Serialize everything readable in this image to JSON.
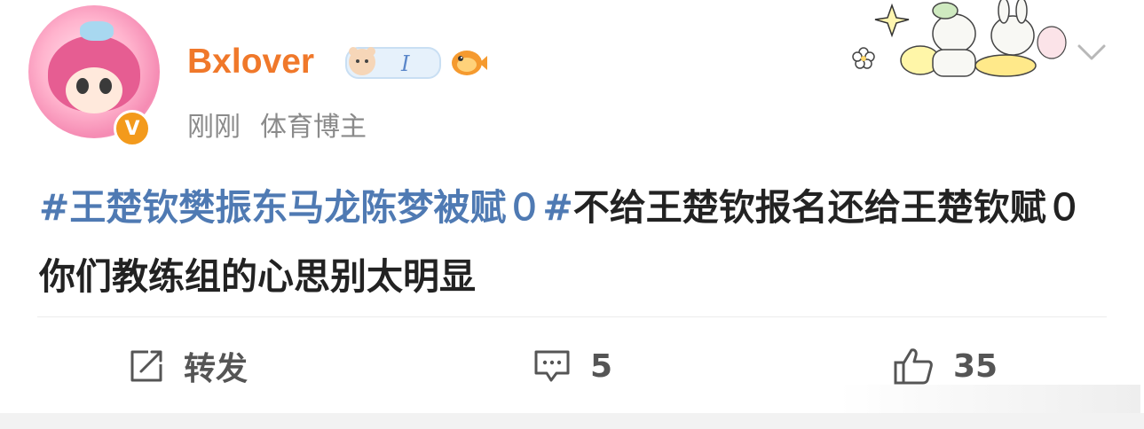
{
  "user": {
    "name": "Bxlover",
    "verified_mark": "V",
    "time": "刚刚",
    "role": "体育博主",
    "badge_letter": "I"
  },
  "post": {
    "topic": "#王楚钦樊振东马龙陈梦被赋０#",
    "text": "不给王楚钦报名还给王楚钦赋０ 你们教练组的心思别太明显"
  },
  "actions": {
    "repost_label": "转发",
    "comment_count": "5",
    "like_count": "35"
  },
  "icons": {
    "repost": "share-square-icon",
    "comment": "comment-bubble-icon",
    "like": "thumbs-up-icon",
    "more": "chevron-down-icon"
  },
  "colors": {
    "username": "#f0782a",
    "topic": "#4f7ab3",
    "meta": "#8a8a8a",
    "verified": "#f39a1c"
  }
}
